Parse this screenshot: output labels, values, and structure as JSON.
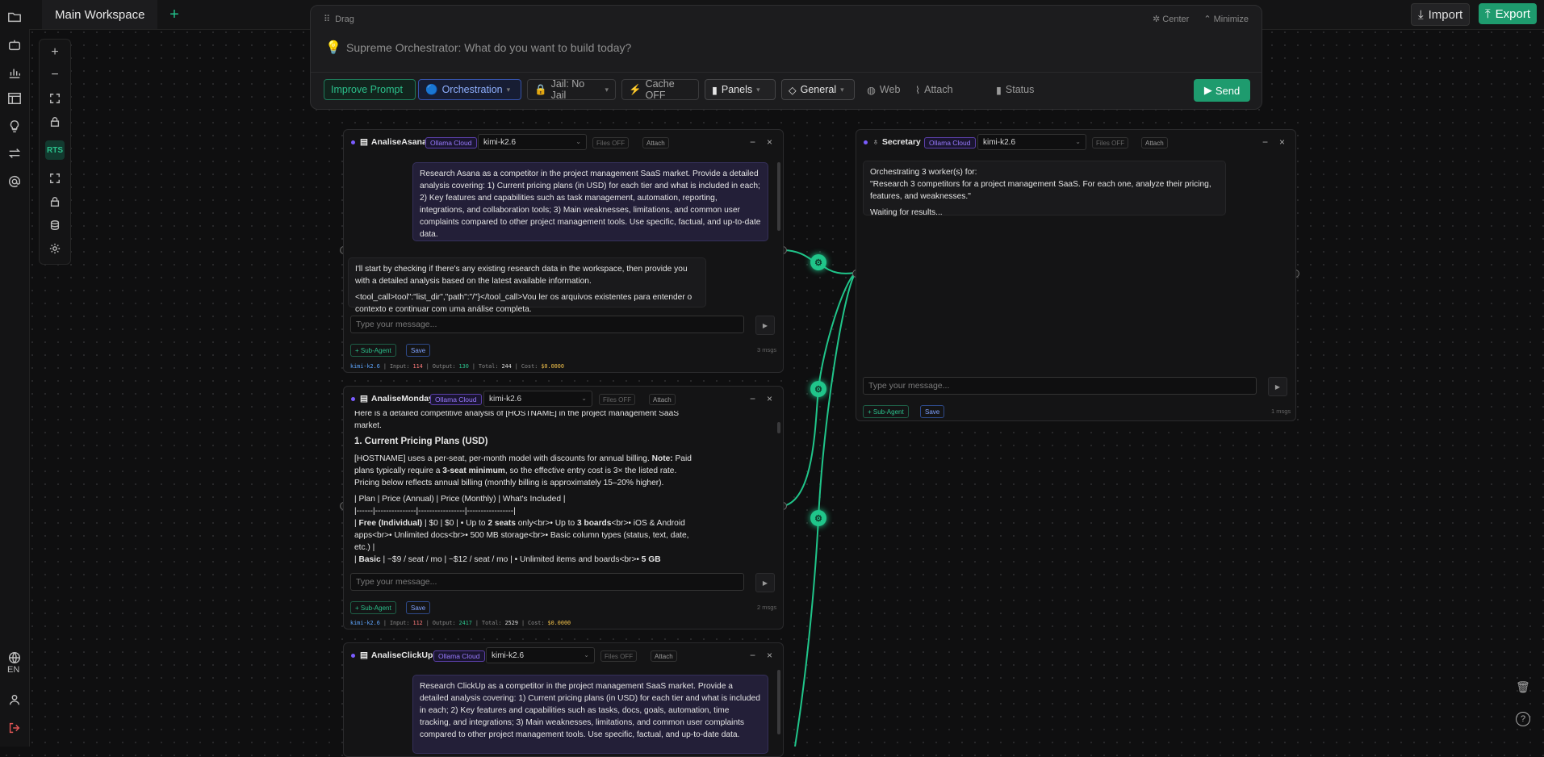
{
  "tabs": {
    "main": "Main Workspace",
    "add": "+"
  },
  "topright": {
    "import": "Import",
    "export": "Export"
  },
  "rail": {
    "language": "EN"
  },
  "zoombar": {
    "plus": "+",
    "minus": "−",
    "rts": "RTS"
  },
  "orchestrator": {
    "drag": "Drag",
    "center": "Center",
    "minimize": "Minimize",
    "placeholder": "Supreme Orchestrator: What do you want to build today?",
    "chips": {
      "improve": "Improve Prompt",
      "orchestration": "Orchestration",
      "jail": "Jail: No Jail",
      "cache": "Cache OFF",
      "panels": "Panels",
      "general": "General",
      "web": "Web",
      "attach": "Attach",
      "status": "Status"
    },
    "send": "Send"
  },
  "common": {
    "badge": "Ollama Cloud",
    "model": "kimi-k2.6",
    "files": "Files OFF",
    "attach": "Attach",
    "input_placeholder": "Type your message...",
    "subagent": "+ Sub-Agent",
    "save": "Save",
    "minimize": "−",
    "close": "×",
    "send": "▶"
  },
  "agents": {
    "asana": {
      "title": "AnaliseAsana",
      "user_msg": "Research Asana as a competitor in the project management SaaS market. Provide a detailed analysis covering: 1) Current pricing plans (in USD) for each tier and what is included in each; 2) Key features and capabilities such as task management, automation, reporting, integrations, and collaboration tools; 3) Main weaknesses, limitations, and common user complaints compared to other project management tools. Use specific, factual, and up-to-date data.",
      "reply_p1": "I'll start by checking if there's any existing research data in the workspace, then provide you with a detailed analysis based on the latest available information.",
      "reply_p2": "<tool_call>tool\":\"list_dir\",\"path\":\"/\"}</tool_call>Vou ler os arquivos existentes para entender o contexto e continuar com uma análise completa.",
      "msgs": "3 msgs",
      "stats": {
        "model": "kimi-k2.6",
        "input_label": "Input:",
        "input": "114",
        "output_label": "Output:",
        "output": "130",
        "total_label": "Total:",
        "total": "244",
        "cost_label": "Cost:",
        "cost": "$0.0000"
      }
    },
    "monday": {
      "title": "AnaliseMonday",
      "p_intro": "Here is a detailed competitive analysis of [HOSTNAME] in the project management SaaS market.",
      "h1": "1. Current Pricing Plans (USD)",
      "p_pricing_a": "[HOSTNAME] uses a per-seat, per-month model with discounts for annual billing. ",
      "p_pricing_note": "Note:",
      "p_pricing_b": " Paid plans typically require a ",
      "p_pricing_bold": "3-seat minimum",
      "p_pricing_c": ", so the effective entry cost is 3× the listed rate. Pricing below reflects annual billing (monthly billing is approximately 15–20% higher).",
      "table_head": "| Plan | Price (Annual) | Price (Monthly) | What's Included |",
      "table_sep": "|------|---------------|-----------------|-----------------|",
      "row_free_a": "| ",
      "row_free_bold": "Free (Individual)",
      "row_free_b": " | $0 | $0 | • Up to ",
      "row_free_bold2": "2 seats",
      "row_free_c": " only<br>• Up to ",
      "row_free_bold3": "3 boards",
      "row_free_d": "<br>• iOS & Android apps<br>• Unlimited docs<br>• 500 MB storage<br>• Basic column types (status, text, date, etc.) |",
      "row_basic_a": "| ",
      "row_basic_bold": "Basic",
      "row_basic_b": " | ~$9 / seat / mo | ~$12 / seat / mo | • Unlimited items and boards<br>• ",
      "row_basic_bold2": "5 GB",
      "msgs": "2 msgs",
      "stats": {
        "model": "kimi-k2.6",
        "input_label": "Input:",
        "input": "112",
        "output_label": "Output:",
        "output": "2417",
        "total_label": "Total:",
        "total": "2529",
        "cost_label": "Cost:",
        "cost": "$0.0000"
      }
    },
    "clickup": {
      "title": "AnaliseClickUp",
      "user_msg": "Research ClickUp as a competitor in the project management SaaS market. Provide a detailed analysis covering: 1) Current pricing plans (in USD) for each tier and what is included in each; 2) Key features and capabilities such as tasks, docs, goals, automation, time tracking, and integrations; 3) Main weaknesses, limitations, and common user complaints compared to other project management tools. Use specific, factual, and up-to-date data."
    },
    "secretary": {
      "title": "Secretary",
      "line1": "Orchestrating 3 worker(s) for:",
      "line2": "\"Research 3 competitors for a project management SaaS. For each one, analyze their pricing, features, and weaknesses.\"",
      "line3": "Waiting for results...",
      "msgs": "1 msgs"
    }
  },
  "colors": {
    "accent": "#1e9b6e",
    "edge": "#20c58a",
    "badge": "#9a7bff"
  }
}
